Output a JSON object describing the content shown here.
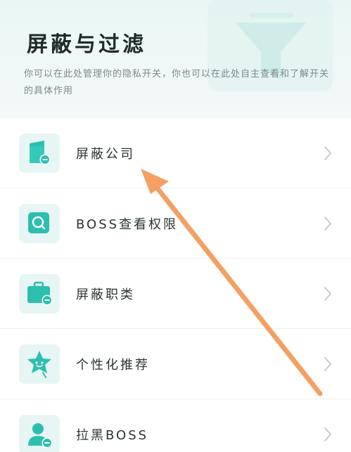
{
  "header": {
    "title": "屏蔽与过滤",
    "subtitle": "你可以在此处管理你的隐私开关，你也可以在此处自主查看和了解开关的具体作用"
  },
  "items": [
    {
      "label": "屏蔽公司",
      "icon": "building-block-icon"
    },
    {
      "label": "BOSS查看权限",
      "icon": "search-icon"
    },
    {
      "label": "屏蔽职类",
      "icon": "briefcase-block-icon"
    },
    {
      "label": "个性化推荐",
      "icon": "star-icon"
    },
    {
      "label": "拉黑BOSS",
      "icon": "user-block-icon"
    }
  ],
  "colors": {
    "accent": "#2cbfb0",
    "annotation_arrow": "#f4a063"
  }
}
